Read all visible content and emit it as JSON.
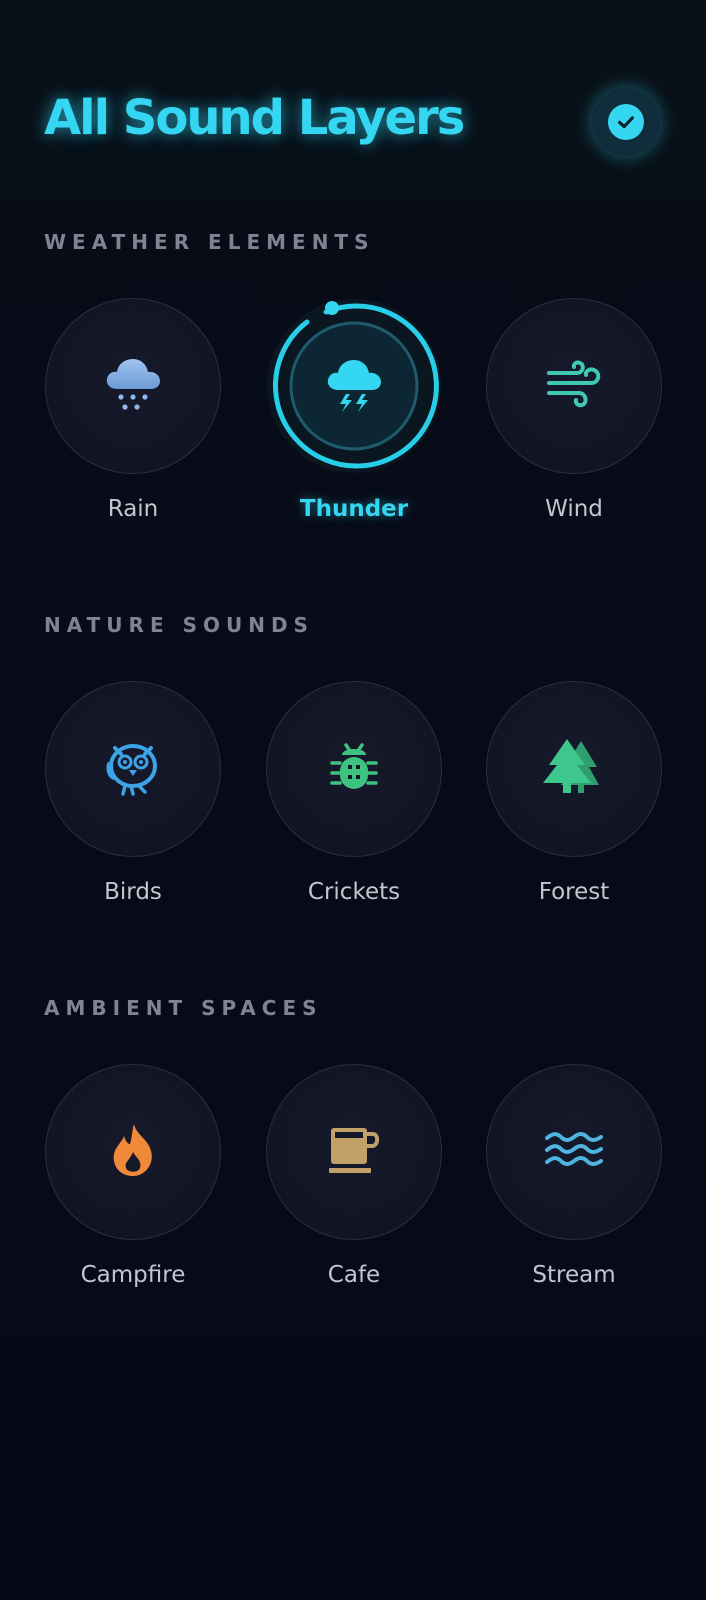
{
  "header": {
    "title": "All Sound Layers"
  },
  "sections": [
    {
      "label": "WEATHER ELEMENTS",
      "items": [
        {
          "label": "Rain",
          "icon": "cloud-rain-icon",
          "color": "#8fb6e8"
        },
        {
          "label": "Thunder",
          "icon": "cloud-lightning-icon",
          "color": "#34d6f2",
          "active": true
        },
        {
          "label": "Wind",
          "icon": "wind-icon",
          "color": "#40c9b0"
        }
      ]
    },
    {
      "label": "NATURE SOUNDS",
      "items": [
        {
          "label": "Birds",
          "icon": "owl-icon",
          "color": "#3ba3e6"
        },
        {
          "label": "Crickets",
          "icon": "bug-icon",
          "color": "#3ec280"
        },
        {
          "label": "Forest",
          "icon": "trees-icon",
          "color": "#3ec78c"
        }
      ]
    },
    {
      "label": "AMBIENT SPACES",
      "items": [
        {
          "label": "Campfire",
          "icon": "fire-icon",
          "color": "#f08a3a"
        },
        {
          "label": "Cafe",
          "icon": "coffee-mug-icon",
          "color": "#c2a06a"
        },
        {
          "label": "Stream",
          "icon": "water-waves-icon",
          "color": "#4fb4e0"
        }
      ]
    }
  ],
  "colors": {
    "accent": "#34d6f2",
    "background": "#080b16",
    "section_label": "#7e8492"
  }
}
